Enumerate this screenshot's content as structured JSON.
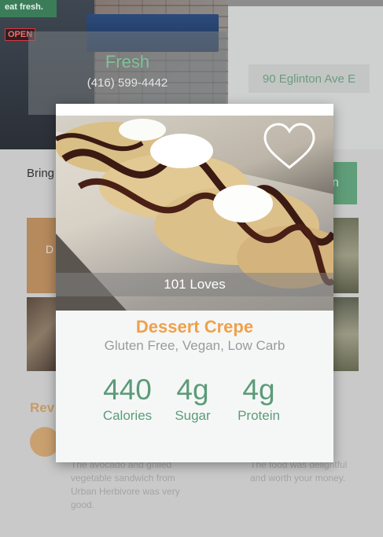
{
  "restaurant": {
    "store_sign": "eat fresh.",
    "open_sign": "OPEN",
    "name": "Fresh",
    "phone": "(416) 599-4442",
    "address": "90 Eglinton Ave E"
  },
  "background_page": {
    "intro_text": "Bring cuisi",
    "green_button_label": "n",
    "tile_label": "D",
    "reviews_heading": "Rev",
    "reviews": [
      {
        "text": "The avocado and grilled vegetable sandwich from Urban Herbivore was very good."
      },
      {
        "text": "The food was delightful and worth your money."
      }
    ]
  },
  "modal": {
    "loves": "101 Loves",
    "dish_name": "Dessert Crepe",
    "tags": "Gluten Free, Vegan, Low Carb",
    "stats": [
      {
        "value": "440",
        "label": "Calories"
      },
      {
        "value": "4g",
        "label": "Sugar"
      },
      {
        "value": "4g",
        "label": "Protein"
      }
    ],
    "favorite_icon": "heart-outline-icon"
  },
  "colors": {
    "accent_green": "#5c9b78",
    "accent_orange": "#f0a04a",
    "name_green": "#7fc19c"
  }
}
